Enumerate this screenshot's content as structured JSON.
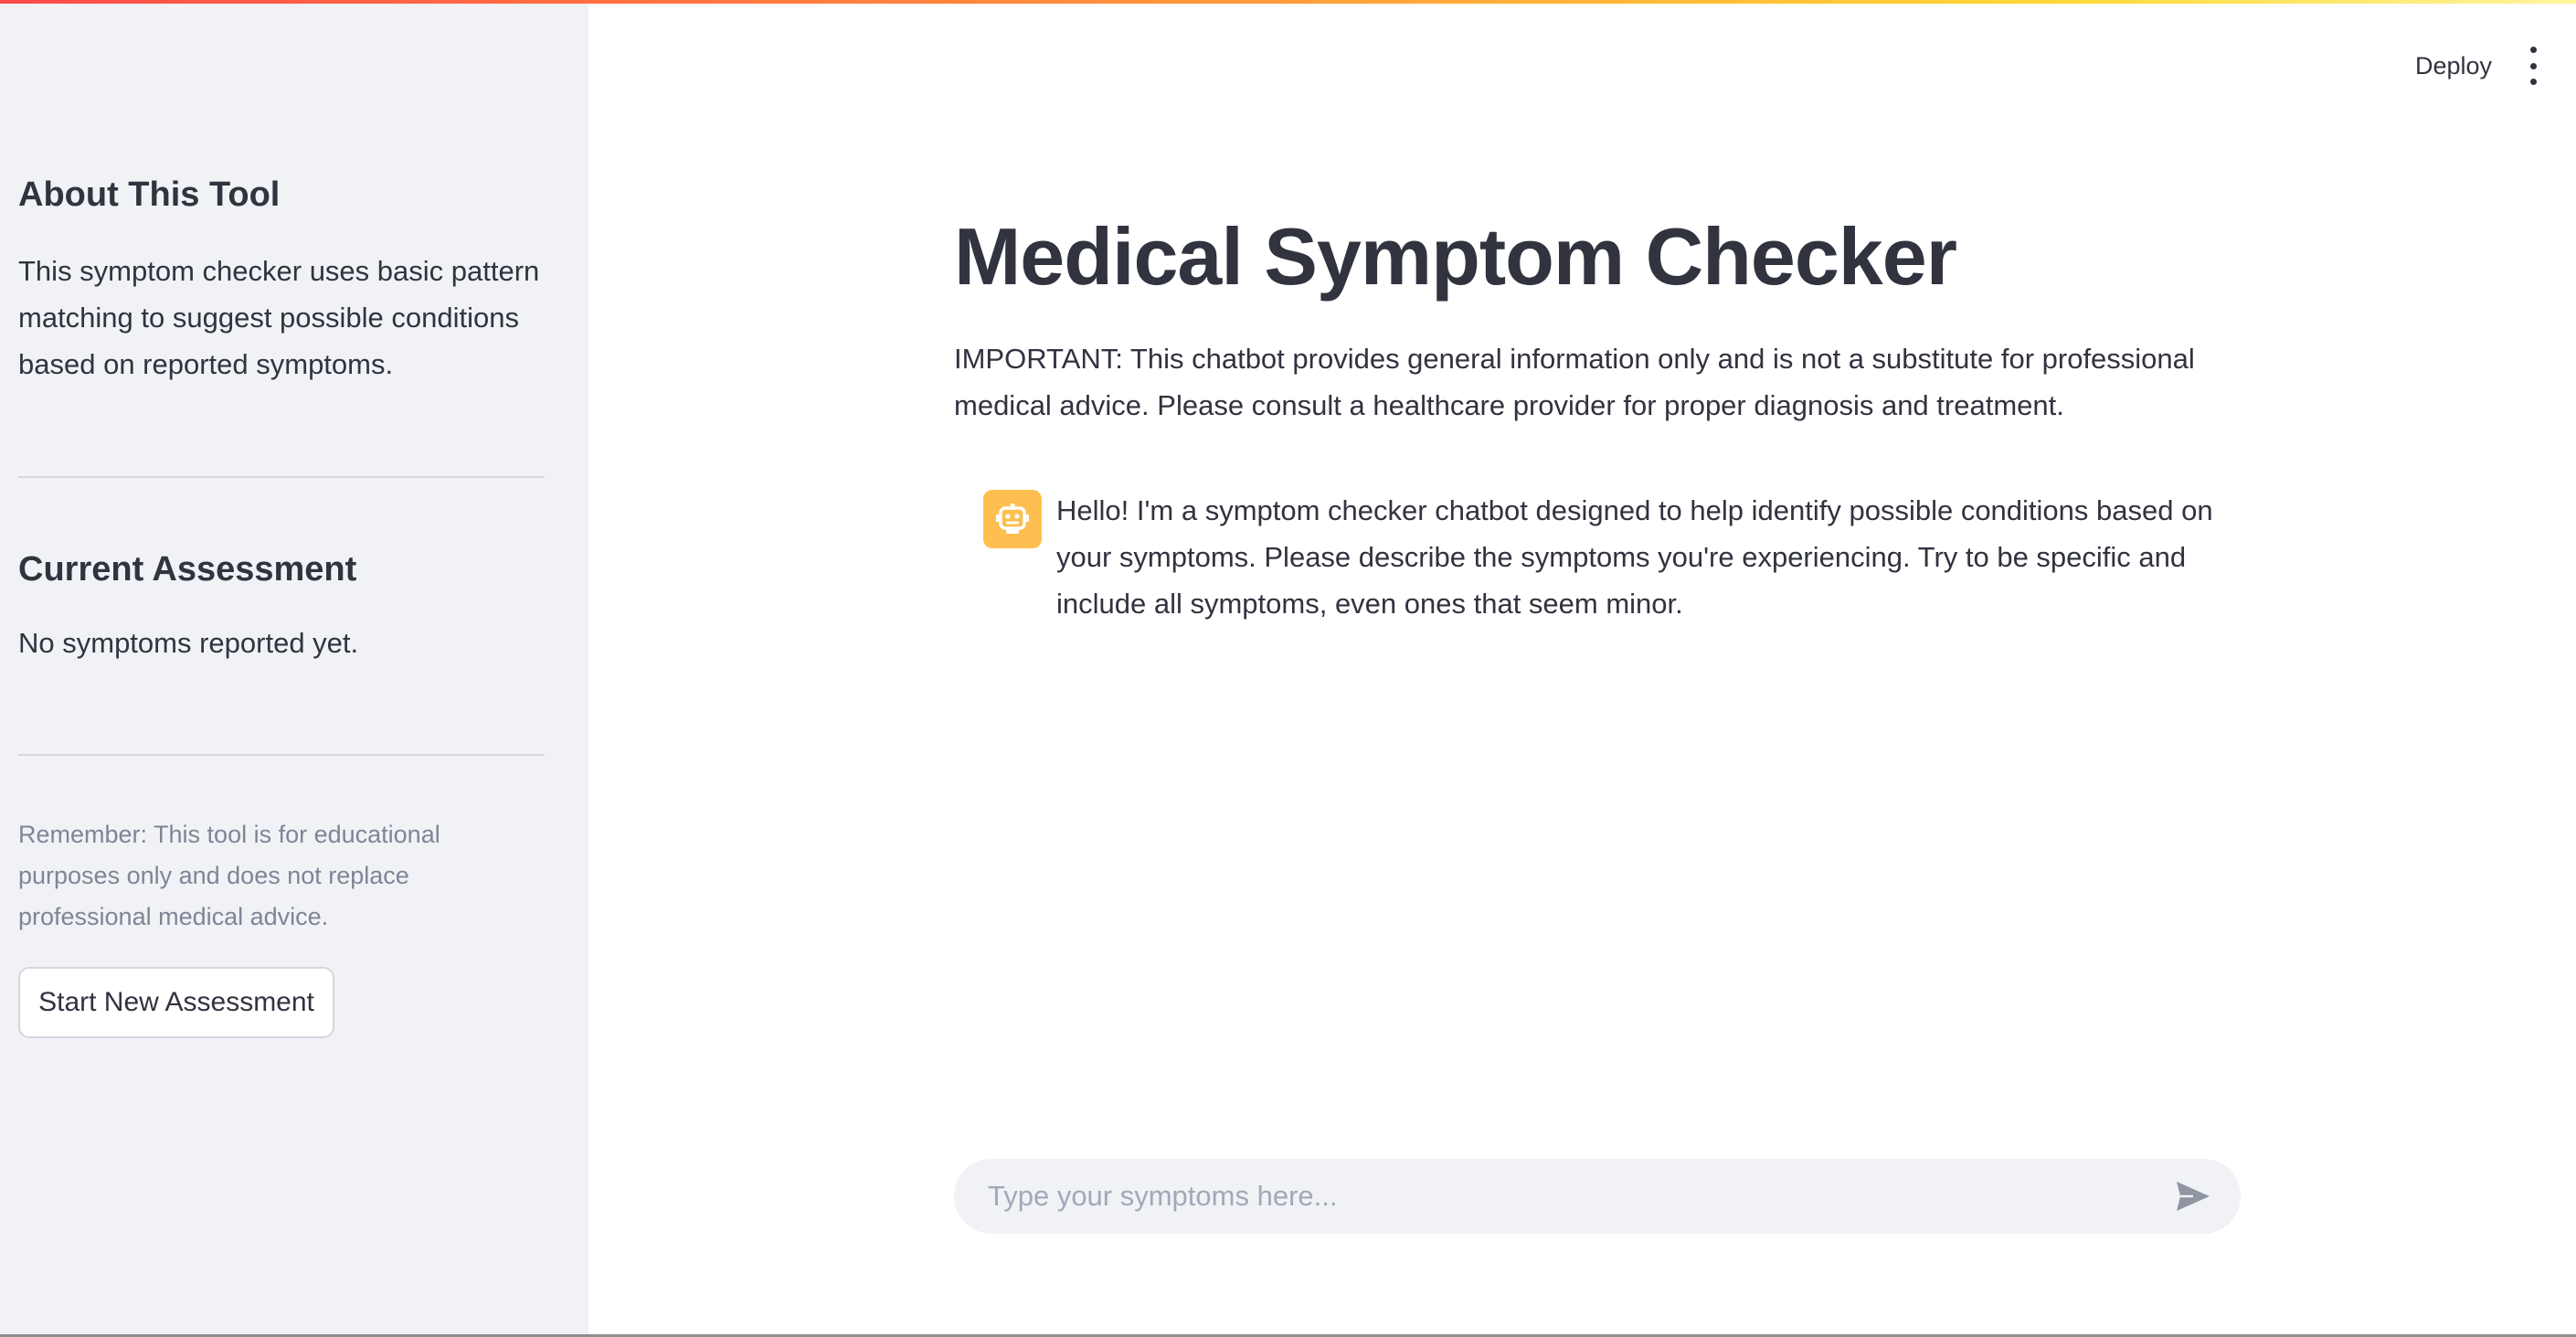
{
  "colors": {
    "sidebar_bg": "#f0f2f6",
    "text": "#31333f",
    "muted_text": "#808495",
    "avatar_bg": "#fdbf4f",
    "input_bg": "#f0f2f6",
    "placeholder": "#a3a8b8",
    "accent_gradient_start": "#ff4b4b",
    "accent_gradient_end": "#fff59d"
  },
  "header": {
    "deploy_label": "Deploy",
    "menu_icon": "kebab-menu-icon"
  },
  "sidebar": {
    "about": {
      "heading": "About This Tool",
      "text": "This symptom checker uses basic pattern matching to suggest possible conditions based on reported symptoms."
    },
    "assessment": {
      "heading": "Current Assessment",
      "text": "No symptoms reported yet."
    },
    "note": "Remember: This tool is for educational purposes only and does not replace professional medical advice.",
    "button_label": "Start New Assessment"
  },
  "main": {
    "title": "Medical Symptom Checker",
    "disclaimer": "IMPORTANT: This chatbot provides general information only and is not a substitute for professional medical advice. Please consult a healthcare provider for proper diagnosis and treatment.",
    "messages": [
      {
        "role": "assistant",
        "avatar_icon": "robot-icon",
        "text": "Hello! I'm a symptom checker chatbot designed to help identify possible conditions based on your symptoms. Please describe the symptoms you're experiencing. Try to be specific and include all symptoms, even ones that seem minor."
      }
    ]
  },
  "chat_input": {
    "placeholder": "Type your symptoms here...",
    "value": "",
    "send_icon": "send-icon"
  }
}
